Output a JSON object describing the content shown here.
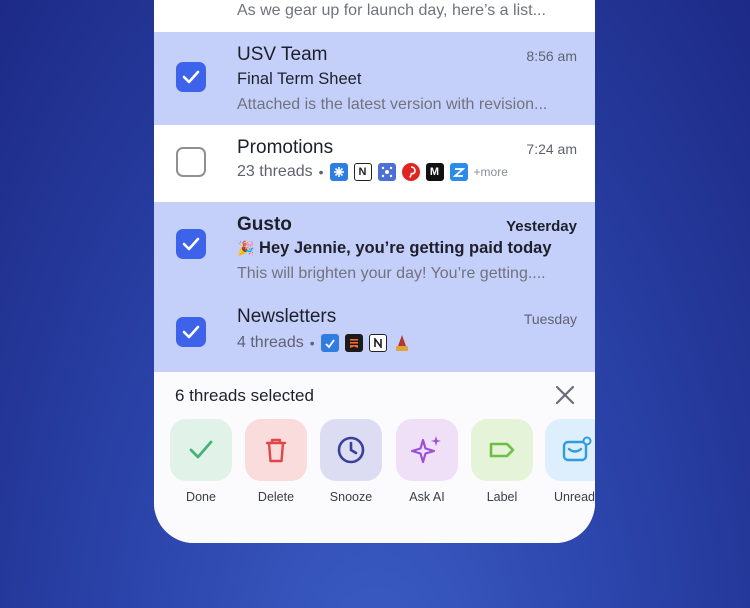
{
  "top_preview": "As we gear up for launch day, here’s a list...",
  "threads": [
    {
      "sender": "USV Team",
      "time": "8:56 am",
      "subject": "Final Term Sheet",
      "preview": "Attached is the latest version with revision...",
      "selected": true
    },
    {
      "sender": "Promotions",
      "time": "7:24 am",
      "count": "23 threads",
      "more": "+more",
      "selected": false
    },
    {
      "sender": "Gusto",
      "time": "Yesterday",
      "subject": "Hey Jennie, you’re getting paid today",
      "subject_emoji": "🎉",
      "preview": "This will brighten your day! You’re getting....",
      "selected": true
    },
    {
      "sender": "Newsletters",
      "time": "Tuesday",
      "count": "4 threads",
      "selected": true
    }
  ],
  "dot": "•",
  "selection_bar": {
    "title": "6 threads selected",
    "actions": [
      {
        "label": "Done",
        "icon": "check-icon",
        "color": "#44b373"
      },
      {
        "label": "Delete",
        "icon": "trash-icon",
        "color": "#e14545"
      },
      {
        "label": "Snooze",
        "icon": "clock-icon",
        "color": "#3b3f9a"
      },
      {
        "label": "Ask AI",
        "icon": "sparkle-icon",
        "color": "#9c4fd6"
      },
      {
        "label": "Label",
        "icon": "tag-icon",
        "color": "#6fbf45"
      },
      {
        "label": "Unread",
        "icon": "mail-unread-icon",
        "color": "#2f9be0"
      }
    ]
  },
  "promo_icons": [
    "N",
    "M"
  ],
  "colors": {
    "selected_row": "#c5d0fa",
    "checkbox": "#3c63ea",
    "background": "#2c46ad"
  }
}
